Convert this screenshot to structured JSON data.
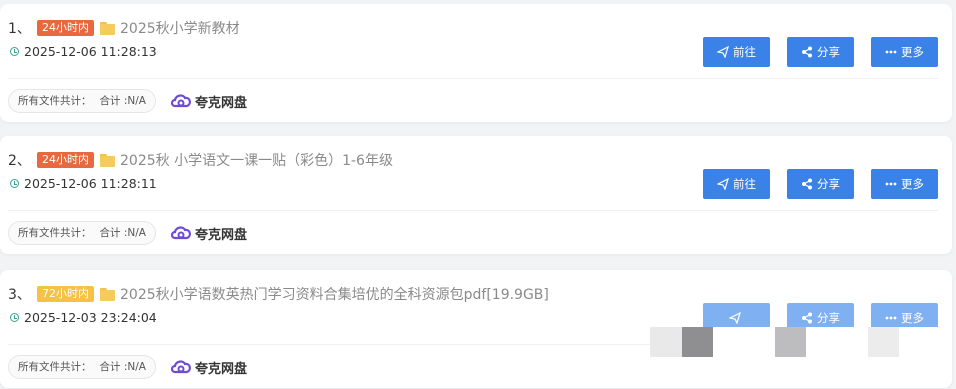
{
  "items": [
    {
      "index": "1、",
      "badge": "24小时内",
      "badge_color": "#e8693f",
      "title": "2025秋小学新教材",
      "time": "2025-12-06 11:28:13",
      "files_label": "所有文件共计：",
      "total_label": "合计 :N/A",
      "provider": "夸克网盘",
      "go_label": "前往",
      "share_label": "分享",
      "more_label": "更多"
    },
    {
      "index": "2、",
      "badge": "24小时内",
      "badge_color": "#e8693f",
      "title": "2025秋 小学语文一课一贴（彩色）1-6年级",
      "time": "2025-12-06 11:28:11",
      "files_label": "所有文件共计：",
      "total_label": "合计 :N/A",
      "provider": "夸克网盘",
      "go_label": "前往",
      "share_label": "分享",
      "more_label": "更多"
    },
    {
      "index": "3、",
      "badge": "72小时内",
      "badge_color": "#f5c244",
      "title": "2025秋小学语数英热门学习资料合集培优的全科资源包pdf[19.9GB]",
      "time": "2025-12-03 23:24:04",
      "files_label": "所有文件共计：",
      "total_label": "合计 :N/A",
      "provider": "夸克网盘",
      "go_label": "",
      "share_label": "分享",
      "more_label": "更多"
    }
  ],
  "icons": {
    "clock": "clock-icon",
    "folder": "folder-icon",
    "send": "send-icon",
    "share": "share-icon",
    "more": "ellipsis-icon",
    "cloud": "quark-cloud-icon"
  }
}
